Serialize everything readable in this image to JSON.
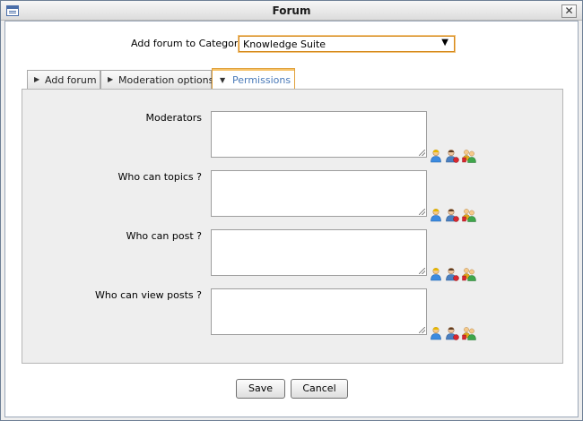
{
  "window": {
    "title": "Forum"
  },
  "form": {
    "category_label": "Add forum to Category:",
    "category_value": "Knowledge Suite"
  },
  "tabs": [
    {
      "label": "Add forum",
      "active": false
    },
    {
      "label": "Moderation options",
      "active": false
    },
    {
      "label": "Permissions",
      "active": true
    }
  ],
  "permissions": {
    "fields": [
      {
        "label": "Moderators",
        "value": ""
      },
      {
        "label": "Who can topics ?",
        "value": ""
      },
      {
        "label": "Who can post ?",
        "value": ""
      },
      {
        "label": "Who can view posts ?",
        "value": ""
      }
    ],
    "field_icons": [
      "select-user-icon",
      "select-membership-icon",
      "select-group-icon"
    ]
  },
  "buttons": {
    "save": "Save",
    "cancel": "Cancel"
  },
  "colors": {
    "active_tab_text": "#4979b8",
    "active_tab_border": "#e0a03a",
    "select_border": "#d58a1e"
  }
}
